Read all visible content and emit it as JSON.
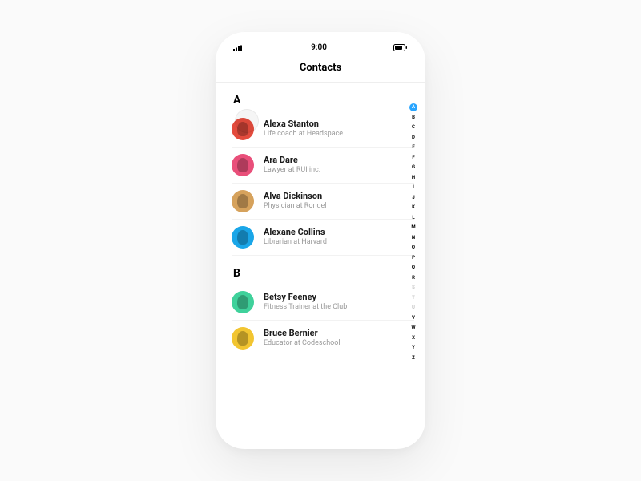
{
  "status_bar": {
    "time": "9:00"
  },
  "nav": {
    "title": "Contacts"
  },
  "sections": [
    {
      "letter": "A",
      "contacts": [
        {
          "name": "Alexa Stanton",
          "sub": "Life coach at Headspace",
          "avatar_color": "#e34b3d"
        },
        {
          "name": "Ara Dare",
          "sub": "Lawyer at RUI inc.",
          "avatar_color": "#e94f7a"
        },
        {
          "name": "Alva Dickinson",
          "sub": "Physician at Rondel",
          "avatar_color": "#d6a25c"
        },
        {
          "name": "Alexane Collins",
          "sub": "Librarian at Harvard",
          "avatar_color": "#1aa6e8"
        }
      ]
    },
    {
      "letter": "B",
      "contacts": [
        {
          "name": "Betsy Feeney",
          "sub": "Fitness Trainer at the Club",
          "avatar_color": "#3fd19b"
        },
        {
          "name": "Bruce Bernier",
          "sub": "Educator at Codeschool",
          "avatar_color": "#f2c531"
        }
      ]
    }
  ],
  "index_rail": {
    "letters": [
      "A",
      "B",
      "C",
      "D",
      "E",
      "F",
      "G",
      "H",
      "I",
      "J",
      "K",
      "L",
      "M",
      "N",
      "O",
      "P",
      "Q",
      "R",
      "S",
      "T",
      "U",
      "V",
      "W",
      "X",
      "Y",
      "Z"
    ],
    "active": "A",
    "dim": [
      "S",
      "T",
      "U"
    ]
  }
}
